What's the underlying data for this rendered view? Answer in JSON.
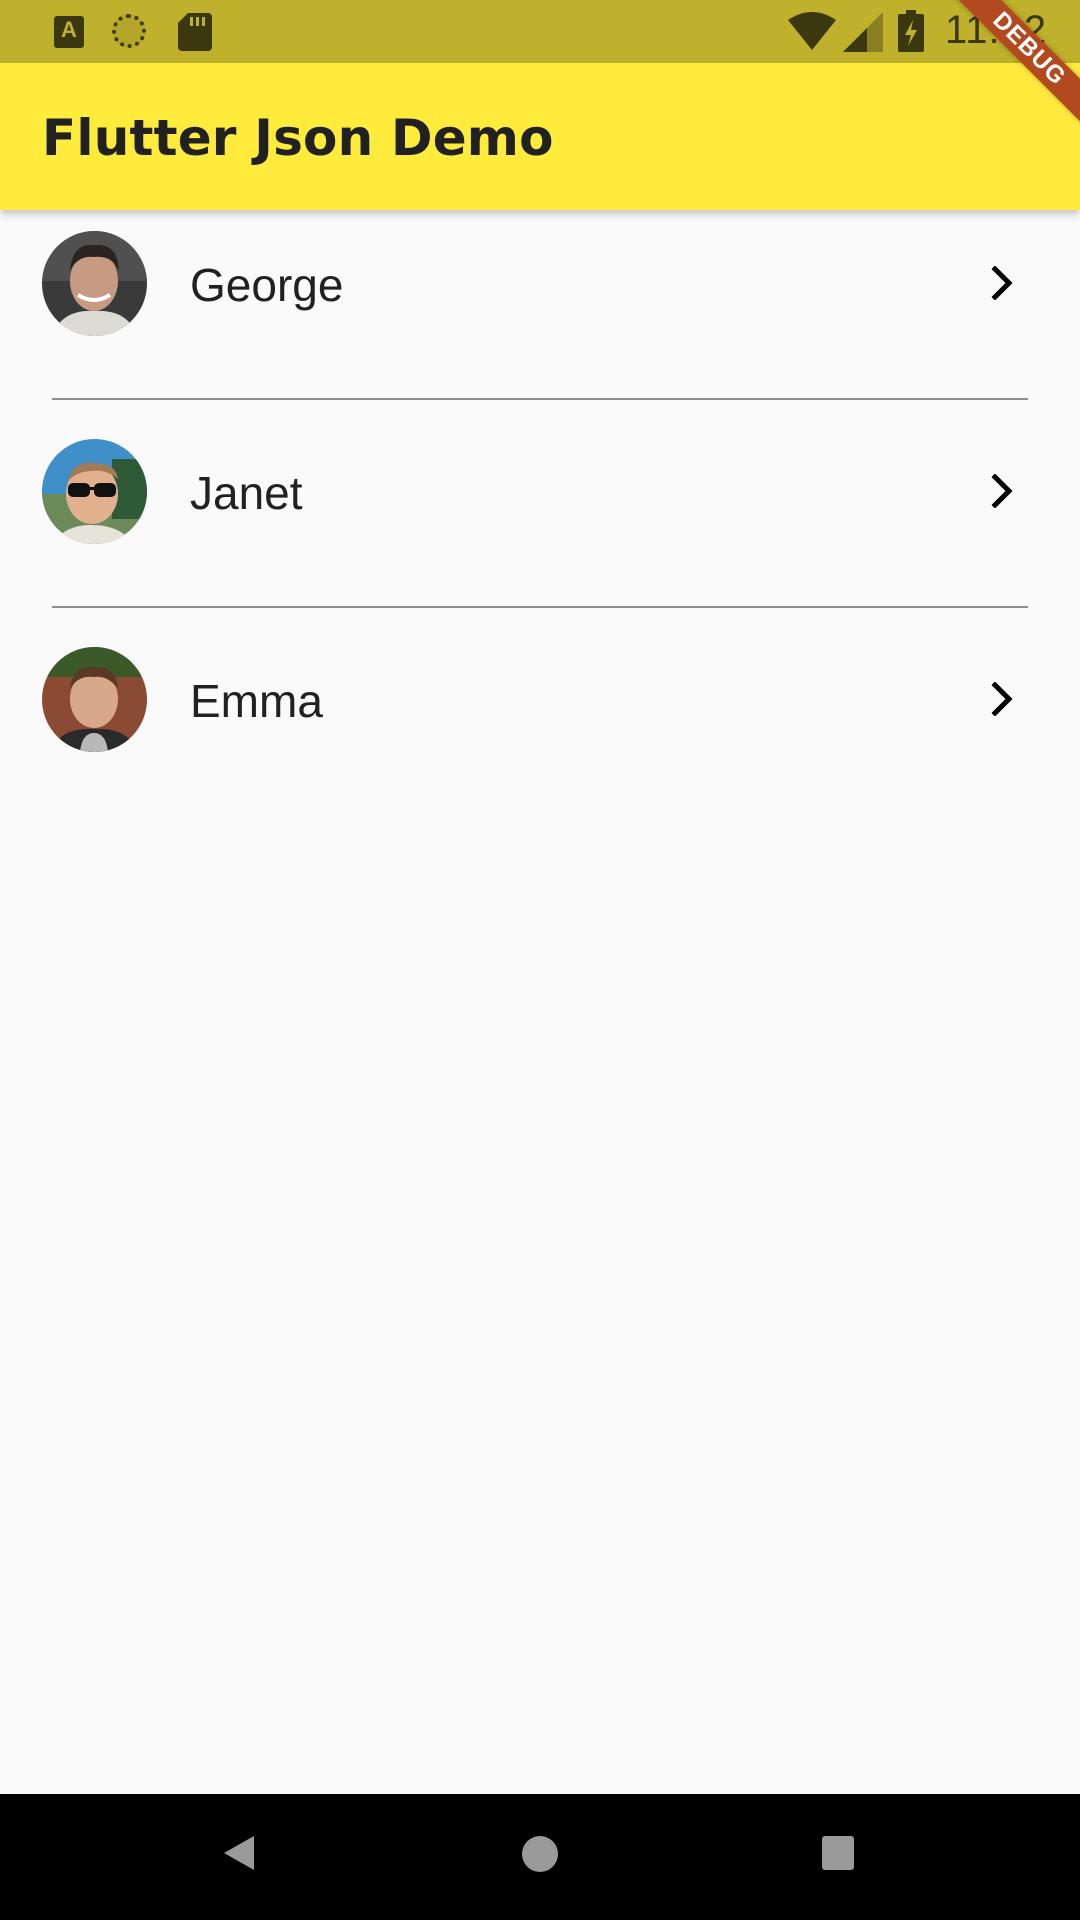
{
  "status_bar": {
    "time": "11:22",
    "left_icons": [
      "a-notification-icon",
      "sync-icon",
      "sd-card-icon"
    ],
    "right_icons": [
      "wifi-icon",
      "signal-icon",
      "battery-charging-icon"
    ]
  },
  "app_bar": {
    "title": "Flutter Json Demo",
    "debug_banner": "DEBUG",
    "background": "#ffeb3b"
  },
  "list": {
    "items": [
      {
        "name": "George",
        "avatar": "avatar-george"
      },
      {
        "name": "Janet",
        "avatar": "avatar-janet"
      },
      {
        "name": "Emma",
        "avatar": "avatar-emma"
      }
    ]
  },
  "nav_bar": {
    "buttons": [
      "back-icon",
      "home-icon",
      "recents-icon"
    ]
  }
}
